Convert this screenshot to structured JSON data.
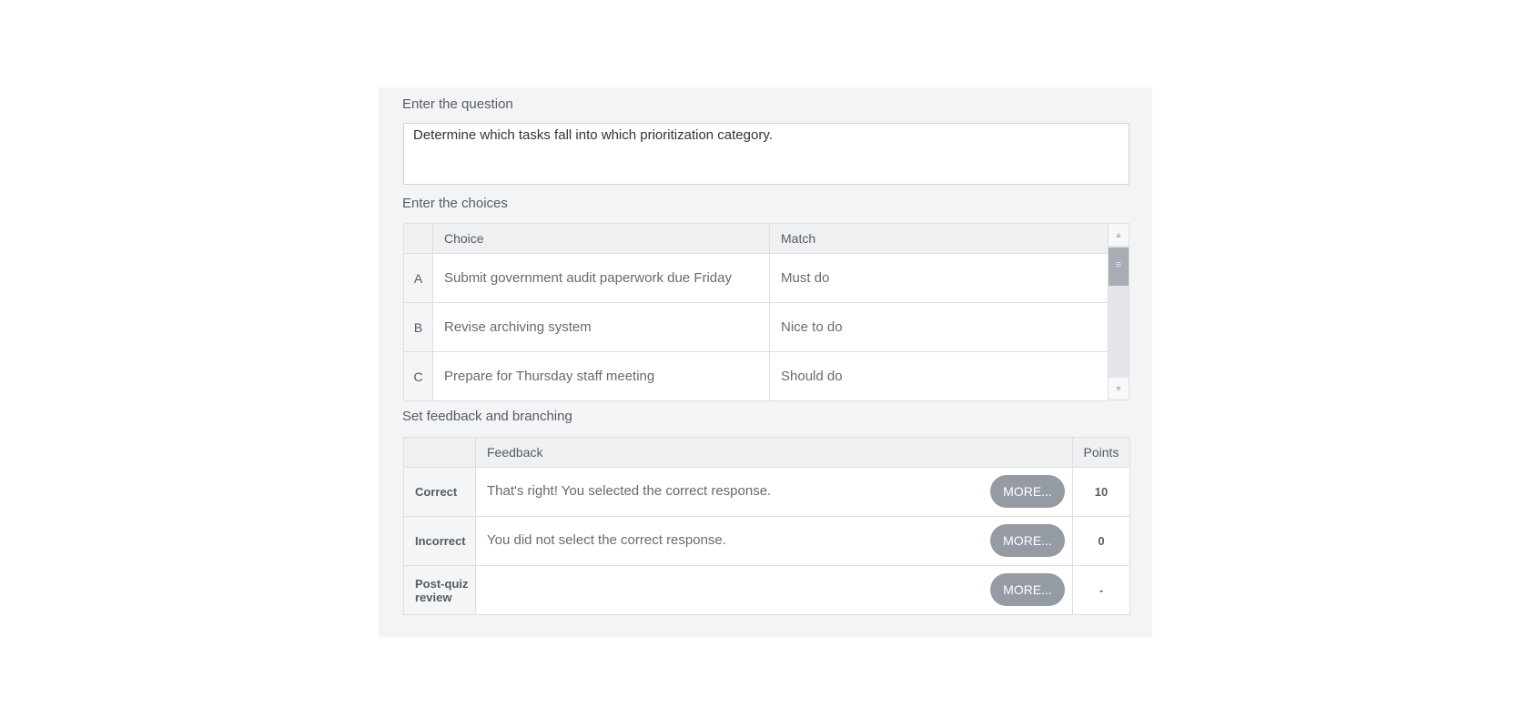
{
  "question": {
    "label": "Enter the question",
    "text": "Determine which tasks fall into which prioritization category."
  },
  "choices": {
    "label": "Enter the choices",
    "headers": {
      "choice": "Choice",
      "match": "Match"
    },
    "rows": [
      {
        "letter": "A",
        "choice": "Submit government audit paperwork due Friday",
        "match": "Must do"
      },
      {
        "letter": "B",
        "choice": "Revise archiving system",
        "match": "Nice to do"
      },
      {
        "letter": "C",
        "choice": "Prepare for Thursday staff meeting",
        "match": "Should do"
      }
    ]
  },
  "feedback": {
    "label": "Set feedback and branching",
    "headers": {
      "feedback": "Feedback",
      "points": "Points"
    },
    "more_label": "MORE...",
    "rows": [
      {
        "label": "Correct",
        "text": "That's right!  You selected the correct response.",
        "points": "10"
      },
      {
        "label": "Incorrect",
        "text": "You did not select the correct response.",
        "points": "0"
      },
      {
        "label": "Post-quiz review",
        "text": "",
        "points": "-"
      }
    ]
  },
  "icons": {
    "scroll_up": "scroll-up-arrow-icon",
    "scroll_down": "scroll-down-arrow-icon",
    "scroll_grip": "grip-lines-icon"
  }
}
